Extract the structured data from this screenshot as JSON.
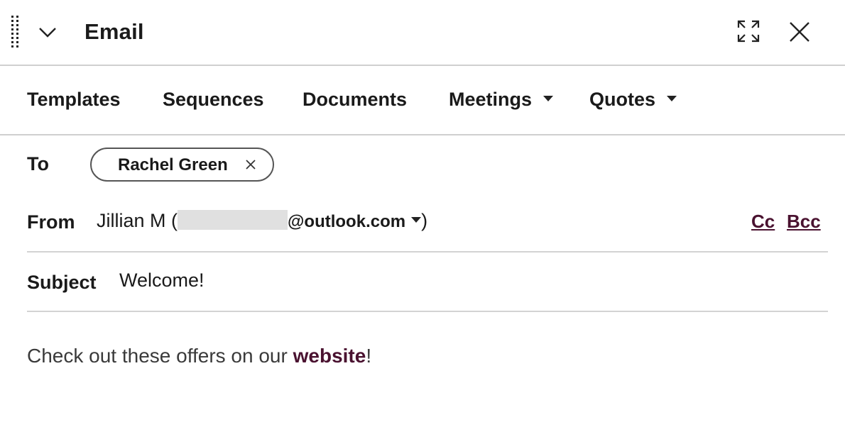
{
  "header": {
    "title": "Email",
    "icons": {
      "drag": "drag-handle-icon",
      "collapse": "chevron-down-icon",
      "expand": "expand-icon",
      "close": "close-icon"
    }
  },
  "toolbar": {
    "templates": "Templates",
    "sequences": "Sequences",
    "documents": "Documents",
    "meetings": "Meetings",
    "quotes": "Quotes"
  },
  "compose": {
    "to_label": "To",
    "recipient": "Rachel Green",
    "from_label": "From",
    "from_name": "Jillian M (",
    "from_domain": "@outlook.com",
    "from_close": ")",
    "cc": "Cc",
    "bcc": "Bcc",
    "subject_label": "Subject",
    "subject_value": "Welcome!",
    "body_prefix": "Check out these offers on our ",
    "body_link": "website",
    "body_suffix": "!"
  },
  "colors": {
    "link": "#4a1230",
    "divider": "#d3d3d3",
    "text": "#1a1a1a"
  }
}
